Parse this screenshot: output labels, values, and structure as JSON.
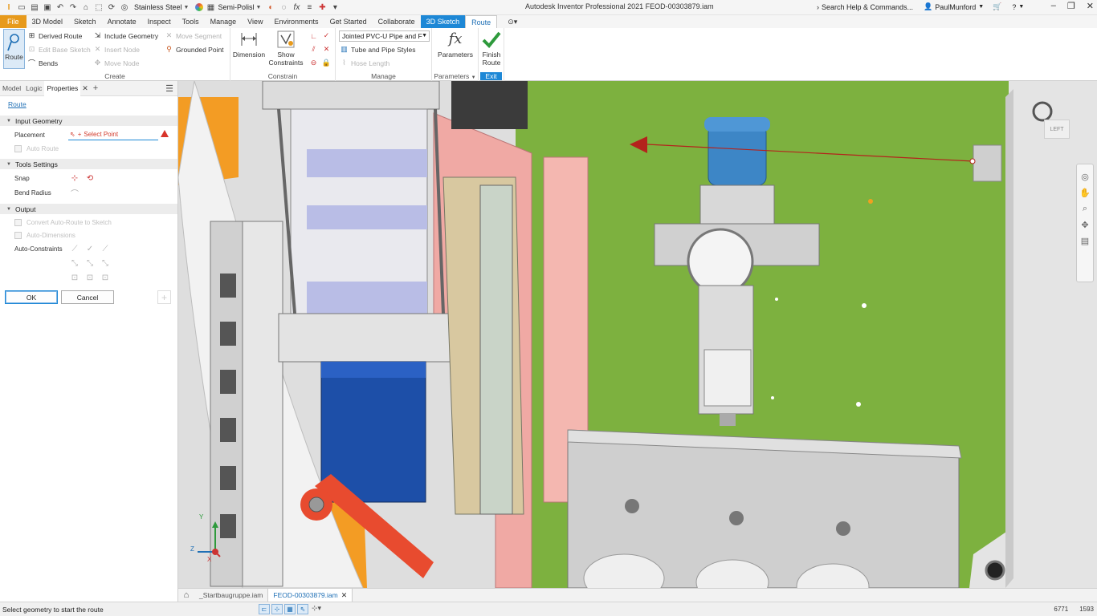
{
  "titlebar": {
    "material": "Stainless Steel",
    "appearance": "Semi-Polisl",
    "app_title": "Autodesk Inventor Professional 2021   FEOD-00303879.iam",
    "search_placeholder": "Search Help & Commands...",
    "user": "PaulMunford",
    "colors": {
      "file_tab": "#e79a1c",
      "context_tab": "#1e88d6"
    }
  },
  "tabs": [
    "File",
    "3D Model",
    "Sketch",
    "Annotate",
    "Inspect",
    "Tools",
    "Manage",
    "View",
    "Environments",
    "Get Started",
    "Collaborate",
    "3D Sketch",
    "Route"
  ],
  "ribbon": {
    "create": {
      "label": "Create",
      "route": "Route",
      "derived_route": "Derived Route",
      "edit_base_sketch": "Edit Base Sketch",
      "bends": "Bends",
      "include_geometry": "Include Geometry",
      "insert_node": "Insert Node",
      "move_node": "Move Node",
      "move_segment": "Move Segment",
      "grounded_point": "Grounded Point"
    },
    "constrain": {
      "label": "Constrain",
      "dimension": "Dimension",
      "show_constraints_1": "Show",
      "show_constraints_2": "Constraints"
    },
    "manage": {
      "label": "Manage",
      "style": "Jointed PVC-U Pipe and F",
      "tube_and_pipe_styles": "Tube and Pipe Styles",
      "hose_length": "Hose Length"
    },
    "parameters": {
      "label": "Parameters",
      "button": "Parameters",
      "icon_text": "fx"
    },
    "exit": {
      "label": "Exit",
      "finish_1": "Finish",
      "finish_2": "Route"
    }
  },
  "panel": {
    "tabs": [
      "Model",
      "Logic",
      "Properties"
    ],
    "breadcrumb": "Route",
    "input_geometry": "Input Geometry",
    "placement": "Placement",
    "select_point": "Select Point",
    "auto_route": "Auto Route",
    "tools_settings": "Tools Settings",
    "snap": "Snap",
    "bend_radius": "Bend Radius",
    "output": "Output",
    "convert_auto_route": "Convert Auto-Route to Sketch",
    "auto_dimensions": "Auto-Dimensions",
    "auto_constraints": "Auto-Constraints",
    "ok": "OK",
    "cancel": "Cancel"
  },
  "viewport": {
    "viewcube_label": "LEFT",
    "triad_x": "X",
    "triad_y": "Y",
    "triad_z": "Z"
  },
  "doc_tabs": [
    "_Startbaugruppe.iam",
    "FEOD-00303879.iam"
  ],
  "status": {
    "text": "Select geometry to start the route",
    "num1": "6771",
    "num2": "1593"
  }
}
